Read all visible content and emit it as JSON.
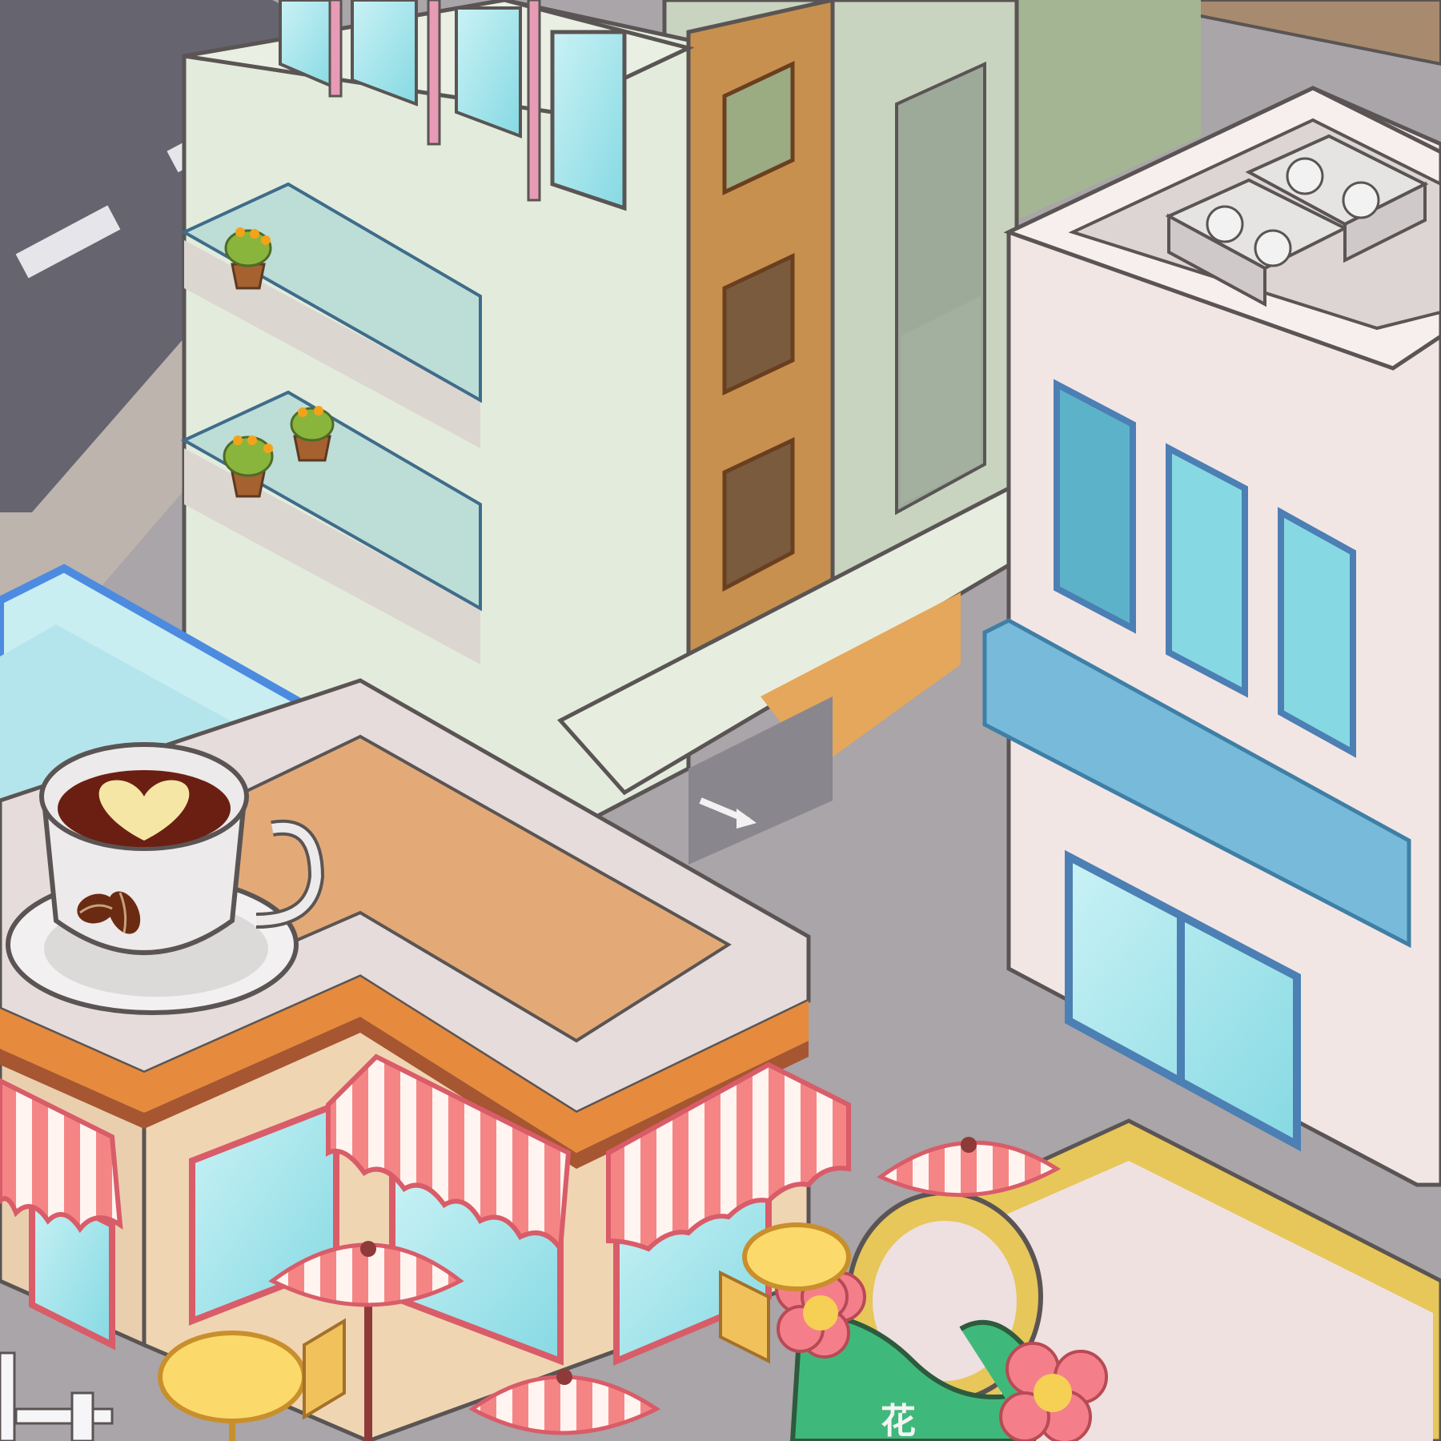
{
  "scene": {
    "style": "isometric-cartoon-city",
    "sign_text": "花"
  },
  "colors": {
    "road": "#66646f",
    "sidewalk": "#a9a5a8",
    "outline": "#5a5554",
    "mint_building": "#e3ecdc",
    "orange_stripe": "#c7904f",
    "white_building": "#f2e6e5",
    "blue_band": "#78bada",
    "window_glass": "#86d9e3",
    "cafe_roof": "#e3aa78",
    "awning_pink": "#f58585",
    "umbrella_pink": "#f58585",
    "table_yellow": "#fbd96b",
    "florist_green": "#3fb97b",
    "flower_pink": "#f47f8a",
    "gold_frame": "#e7c65a"
  },
  "icons": {
    "cup": "coffee-cup-icon",
    "heart": "latte-heart-icon",
    "beans": "coffee-bean-icon",
    "fan": "ac-fan-icon",
    "arrow": "direction-arrow-icon",
    "flower": "flower-icon",
    "plant": "potted-plant-icon"
  }
}
